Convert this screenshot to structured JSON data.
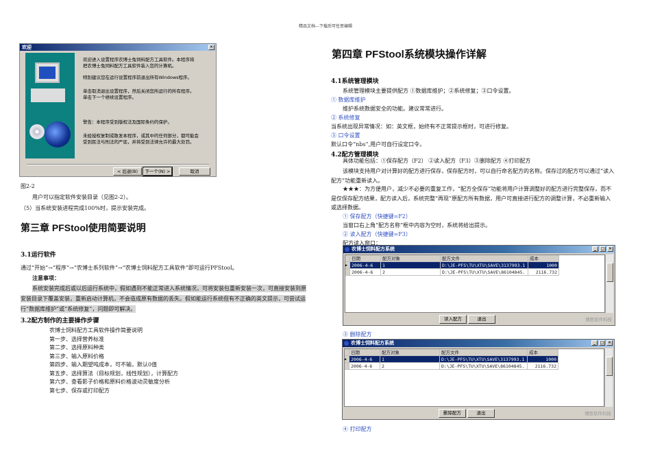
{
  "header": "精品文档---下载后可任意编辑",
  "left": {
    "dialog": {
      "title": "欢迎",
      "lines": [
        "欢迎进入设置程序农博士兔饲料配方工具软件。本程序将",
        "把农博士兔饲料配方工具软件装入您的计算机。",
        "特别建议您在运行设置程序前退出所有Windows程序。",
        "单击取消退出设置程序，然后关闭您所运行的所有程序。",
        "单击下一个继续设置程序。",
        "警告：本程序受到版权法及国际条约的保护。",
        "未经授权复制或散发本程序，或其中的任何部分，都可能会",
        "受到民法与刑法的严惩，并将受到法律允许的最大处罚。"
      ],
      "back": "< 后退(B)",
      "next": "下一个(N) >",
      "cancel": "取消"
    },
    "fig_caption": "图2-2",
    "p1": "用户可以指定软件安装目录（见图2-2）。",
    "p2": "（5）当系统安装进程完成100%时，提示安装完成。",
    "chapter3": "第三章  PFStool使用简要说明",
    "s31": "3.1运行软件",
    "run": "通过“开始”→“程序”→“农博士系列软件”→“农博士饲料配方工具软件”即可运行PFStool。",
    "note_title": "注意事项：",
    "note": [
      "系统安装完成后或以后运行系统中，假如遇到不能正常进入系统情况，可将安装包重新安装一次，可直接安装到原",
      "安装目录下覆盖安装，重新启动计算机，不会造成原有数据的丢失。假如能运行系统但有不正确的英文提示，可尝试运",
      "行“数据库维护”或“系统修复”，问题即可解决。"
    ],
    "s32": "3.2配方制作的主要操作步骤",
    "steps": [
      "农博士饲料配方工具软件操作简要说明",
      "第一步、选择营养标准",
      "第二步、选择原料种类",
      "第三步、输入原料价格",
      "第四步、输入期望吨成本，可不输，默认0值",
      "第五步、选择算法（目标规划，线性规划），计算配方",
      "第六步、查看影子价格和原料价格波动灵敏度分析",
      "第七步、保存或打印配方"
    ]
  },
  "right": {
    "chapter4": "第四章  PFStool系统模块操作详解",
    "s41": "4.1系统管理模块",
    "l41": [
      "系统管理模块主要提供配方 ①数据库维护；②系统修复；③口令设置。",
      "①  数据库维护",
      "维护系统数据安全的功能。建议常常进行。",
      "②  系统修复",
      "当系统出现异常情况：如：英文框，始终有不正常提示框时，可进行修复。",
      "③  口令设置",
      "默认口令“nbs”,用户可自行设定口令。"
    ],
    "s42": "4.2配方管理模块",
    "l42": [
      "具体功能包括：①保存配方（F2） ②读入配方（F3）③删除配方 ④打印配方",
      "该模块支持用户对计算好的配方进行保存，保存配方时，可以自行命名配方的名称。保存过的配方可以通过“读入",
      "配方”功能重新读入。",
      "★★★：为方便用户，减少不必要的重复工作，“配方全保存”功能将用户计算调整好的配方进行完整保存，而不",
      "是仅保存配方结果，配方读入后，系统完整“再现”原配方所有数据，用户可直接进行配方的调整计算，不必重新输入",
      "或选择数据。",
      "① 保存配方（快捷键=F2）",
      "当窗口右上角“配方名称”框中内容为空时，系统将给出提示。",
      "② 读入配方（快捷键=F3）",
      "配方读入窗口："
    ],
    "delete_label": "③ 删除配方",
    "print_label": "④ 打印配方",
    "windows": [
      {
        "title": "农博士饲料配方系统",
        "columns": [
          "日期",
          "配方对象",
          "配方文件",
          "成本"
        ],
        "rows": [
          [
            "2006-4-6",
            "1",
            "D:\\JE-PFS\\TU\\XTU\\SAVE\\3137993.1",
            "1000"
          ],
          [
            "2006-4-6",
            "2",
            "D:\\JE-PFS\\TU\\XTU\\SAVE\\86104845.",
            "2116.732"
          ]
        ],
        "action": "读入配方",
        "exit": "退出",
        "brand": "博思软件科技"
      },
      {
        "title": "农博士饲料配方系统",
        "columns": [
          "日期",
          "配方对象",
          "配方文件",
          "成本"
        ],
        "rows": [
          [
            "2006-4-6",
            "1",
            "D:\\JE-PFS\\TU\\XTU\\SAVE\\3137993.1",
            "1000"
          ],
          [
            "2006-4-6",
            "2",
            "D:\\JE-PFS\\TU\\XTU\\SAVE\\86104845.",
            "2116.732"
          ]
        ],
        "action": "删除配方",
        "exit": "退出",
        "brand": "博思软件科技"
      }
    ]
  }
}
